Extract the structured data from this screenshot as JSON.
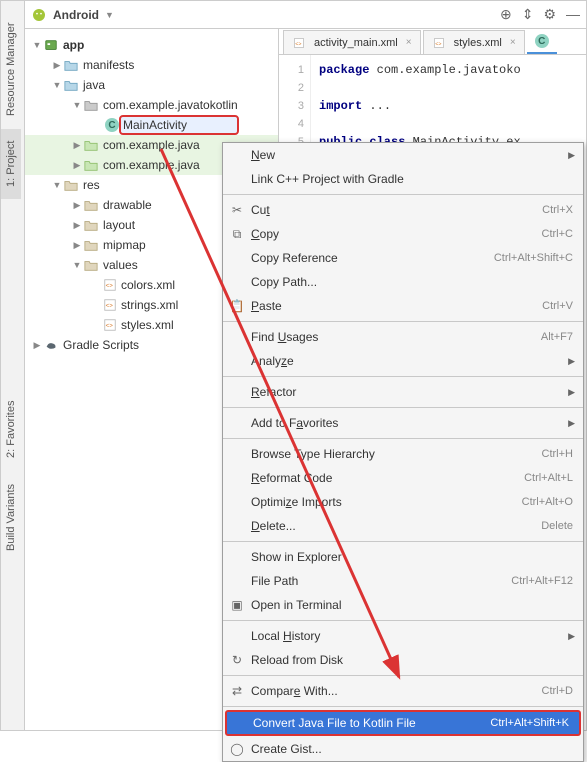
{
  "sidebar_tabs": {
    "resource_manager": "Resource Manager",
    "project": "1: Project",
    "favorites": "2: Favorites",
    "build_variants": "Build Variants"
  },
  "toolbar": {
    "mode_label": "Android"
  },
  "editor": {
    "tabs": [
      {
        "label": "activity_main.xml"
      },
      {
        "label": "styles.xml"
      }
    ],
    "gutter": [
      "1",
      "2",
      "3",
      "4",
      "5"
    ],
    "lines": {
      "l1_kw": "package",
      "l1_rest": " com.example.javatoko",
      "l3_kw": "import",
      "l3_rest": " ...",
      "l5_kw": "public class",
      "l5_rest": " MainActivity ex"
    }
  },
  "tree": {
    "app": "app",
    "manifests": "manifests",
    "java": "java",
    "pkg1": "com.example.javatokotlin",
    "main_activity": "MainActivity",
    "pkg2": "com.example.java",
    "pkg3": "com.example.java",
    "res": "res",
    "drawable": "drawable",
    "layout": "layout",
    "mipmap": "mipmap",
    "values": "values",
    "colors": "colors.xml",
    "strings": "strings.xml",
    "styles": "styles.xml",
    "gradle": "Gradle Scripts"
  },
  "menu": {
    "new": "New",
    "link_cpp": "Link C++ Project with Gradle",
    "cut": "Cut",
    "cut_sc": "Ctrl+X",
    "copy": "Copy",
    "copy_sc": "Ctrl+C",
    "copy_ref": "Copy Reference",
    "copy_ref_sc": "Ctrl+Alt+Shift+C",
    "copy_path": "Copy Path...",
    "paste": "Paste",
    "paste_sc": "Ctrl+V",
    "find_usages": "Find Usages",
    "find_usages_sc": "Alt+F7",
    "analyze": "Analyze",
    "refactor": "Refactor",
    "add_fav": "Add to Favorites",
    "browse_type": "Browse Type Hierarchy",
    "browse_type_sc": "Ctrl+H",
    "reformat": "Reformat Code",
    "reformat_sc": "Ctrl+Alt+L",
    "optimize": "Optimize Imports",
    "optimize_sc": "Ctrl+Alt+O",
    "delete": "Delete...",
    "delete_sc": "Delete",
    "show_explorer": "Show in Explorer",
    "file_path": "File Path",
    "file_path_sc": "Ctrl+Alt+F12",
    "open_terminal": "Open in Terminal",
    "local_history": "Local History",
    "reload": "Reload from Disk",
    "compare": "Compare With...",
    "compare_sc": "Ctrl+D",
    "convert": "Convert Java File to Kotlin File",
    "convert_sc": "Ctrl+Alt+Shift+K",
    "gist": "Create Gist..."
  }
}
